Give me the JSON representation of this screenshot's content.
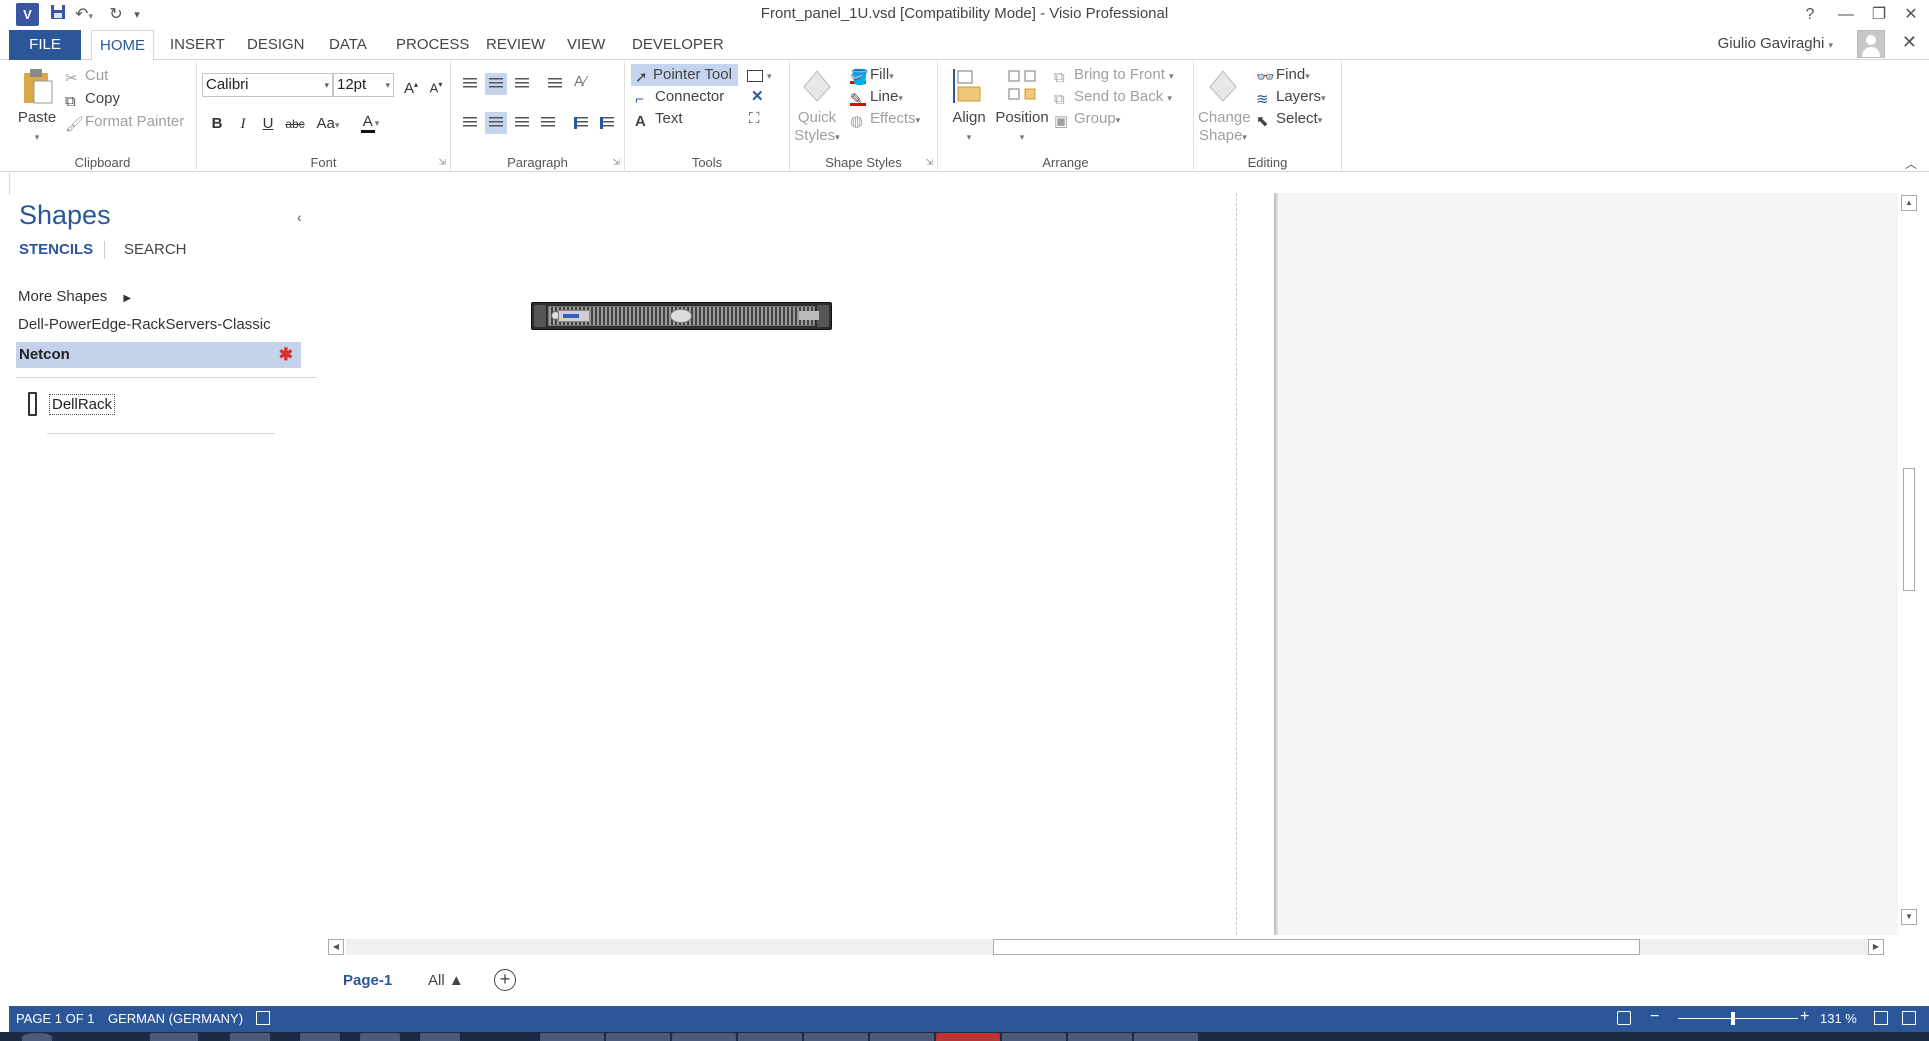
{
  "window": {
    "title": "Front_panel_1U.vsd  [Compatibility Mode] - Visio Professional",
    "app_icon": "V",
    "help": "?",
    "minimize": "—",
    "restore": "❐",
    "close": "✕"
  },
  "tabs": {
    "file": "FILE",
    "items": [
      "HOME",
      "INSERT",
      "DESIGN",
      "DATA",
      "PROCESS",
      "REVIEW",
      "VIEW",
      "DEVELOPER"
    ],
    "active": "HOME"
  },
  "user": {
    "name": "Giulio Gaviraghi"
  },
  "ribbon": {
    "clipboard": {
      "paste": "Paste",
      "cut": "Cut",
      "copy": "Copy",
      "format_painter": "Format Painter",
      "label": "Clipboard"
    },
    "font": {
      "family": "Calibri",
      "size": "12pt",
      "bold": "B",
      "italic": "I",
      "underline": "U",
      "strike": "abc",
      "case": "Aa",
      "color": "A",
      "grow": "A",
      "shrink": "A",
      "label": "Font"
    },
    "paragraph": {
      "label": "Paragraph"
    },
    "tools": {
      "pointer": "Pointer Tool",
      "connector": "Connector",
      "text": "Text",
      "label": "Tools"
    },
    "shape_styles": {
      "quick_styles_1": "Quick",
      "quick_styles_2": "Styles",
      "fill": "Fill",
      "line": "Line",
      "effects": "Effects",
      "label": "Shape Styles"
    },
    "arrange": {
      "align": "Align",
      "position": "Position",
      "bring_front": "Bring to Front",
      "send_back": "Send to Back",
      "group": "Group",
      "label": "Arrange"
    },
    "editing": {
      "change_shape_1": "Change",
      "change_shape_2": "Shape",
      "find": "Find",
      "layers": "Layers",
      "select": "Select",
      "label": "Editing"
    }
  },
  "shapes_pane": {
    "title": "Shapes",
    "tab_stencils": "STENCILS",
    "tab_search": "SEARCH",
    "more_shapes": "More Shapes",
    "stencils": [
      "Dell-PowerEdge-RackServers-Classic",
      "Netcon"
    ],
    "selected_stencil": "Netcon",
    "master": "DellRack"
  },
  "page_tabs": {
    "page": "Page-1",
    "all": "All ▲",
    "add": "+"
  },
  "status": {
    "page": "PAGE 1 OF 1",
    "language": "GERMAN (GERMANY)",
    "zoom": "131 %"
  },
  "colors": {
    "accent": "#2b579a",
    "selection": "#c5d2ec",
    "star": "#d9302c"
  }
}
